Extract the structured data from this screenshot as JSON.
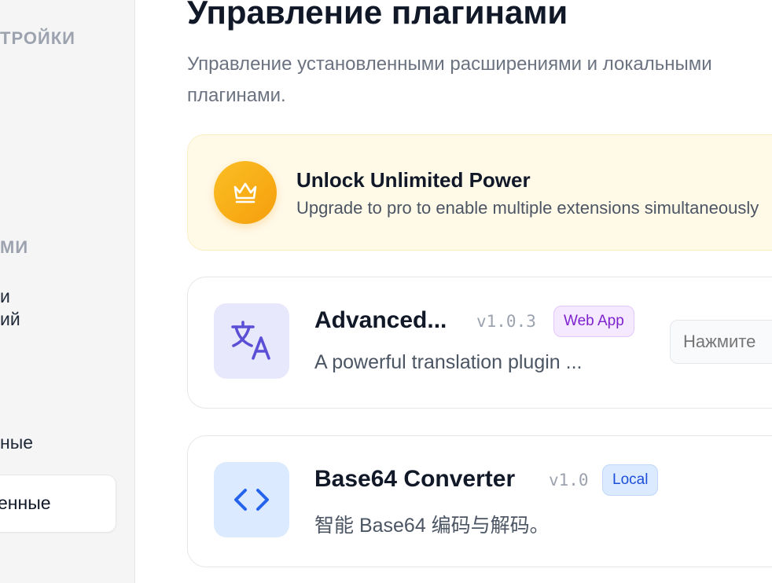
{
  "sidebar": {
    "section_settings": "ТРОЙКИ",
    "section_plugins": "МИ",
    "item_1_line1": "и",
    "item_1_line2": "ий",
    "item_2": "ные",
    "item_active": "енные"
  },
  "main": {
    "title": "Управление плагинами",
    "subtitle": "Управление установленными расширениями и локальными плагинами."
  },
  "promo": {
    "icon": "crown-icon",
    "title": "Unlock Unlimited Power",
    "description": "Upgrade to pro to enable multiple extensions simultaneously"
  },
  "plugins": [
    {
      "name": "Advanced...",
      "version": "v1.0.3",
      "badge": "Web App",
      "description": "A powerful translation plugin ...",
      "icon": "translate-icon",
      "hotkey_placeholder": "Нажмите"
    },
    {
      "name": "Base64 Converter",
      "version": "v1.0",
      "badge": "Local",
      "description": "智能 Base64 编码与解码。",
      "icon": "code-icon"
    }
  ],
  "colors": {
    "accent_purple": "#5b4fd6",
    "accent_blue": "#2563eb",
    "promo_bg": "#fff9e8",
    "crown_gold": "#fbbf24"
  }
}
